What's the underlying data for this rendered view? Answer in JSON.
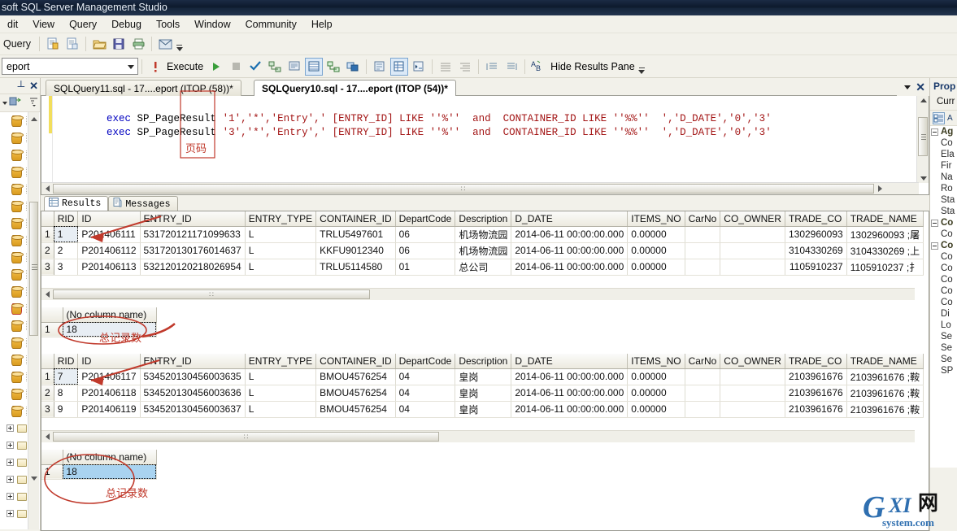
{
  "window": {
    "title": "soft SQL Server Management Studio"
  },
  "menu": {
    "items": [
      "dit",
      "View",
      "Query",
      "Debug",
      "Tools",
      "Window",
      "Community",
      "Help"
    ]
  },
  "toolbar_main": {
    "label": "Query",
    "icons": [
      "new-query-icon",
      "new-query-copy-icon",
      "open-file-icon",
      "save-icon",
      "print-icon",
      "mail-icon"
    ],
    "overflow": "toolbar-overflow-icon"
  },
  "toolbar_query": {
    "database": "eport",
    "execute_label": "Execute",
    "hide_results_label": "Hide Results Pane",
    "icons": [
      "debug-icon",
      "execute-play-icon",
      "stop-icon",
      "parse-check-icon",
      "display-estimated-plan-icon",
      "query-options-icon",
      "results-to-grid-icon",
      "include-actual-plan-icon",
      "results-to-file-icon",
      "design-query-icon",
      "specify-values-icon",
      "sqlcmd-mode-icon",
      "indent-icon",
      "outdent-icon",
      "comment-icon",
      "uncomment-icon",
      "ab-icon"
    ]
  },
  "left_panel": {
    "pin_icon": "pin-icon",
    "close_icon": "close-icon",
    "toolbar_icons": [
      "connect-icon",
      "disconnect-icon",
      "filter-icon"
    ],
    "db_count": 18,
    "folder_count": 6,
    "highlighted_index": 11
  },
  "right_panel": {
    "title": "Prop",
    "subtitle": "Curr",
    "toolbar_icons": [
      "categorized-icon",
      "alphabetical-icon"
    ],
    "groups": [
      {
        "name": "Ag",
        "items": [
          "Co",
          "Ela",
          "Fir",
          "Na",
          "Ro",
          "Sta",
          "Sta"
        ]
      },
      {
        "name": "Co",
        "items": [
          "Co"
        ]
      },
      {
        "name": "Co",
        "items": [
          "Co",
          "Co",
          "Co",
          "Co",
          "Co",
          "Di",
          "Lo",
          "Se",
          "Se",
          "Se",
          "SP"
        ]
      }
    ]
  },
  "tabs": [
    {
      "label": "SQLQuery11.sql - 17....eport (ITOP (58))*",
      "active": false
    },
    {
      "label": "SQLQuery10.sql - 17....eport (ITOP (54))*",
      "active": true
    }
  ],
  "tabstrip": {
    "dropdown_icon": "chevron-down-icon",
    "close_icon": "close-icon"
  },
  "editor": {
    "lines": [
      {
        "kw1": "exec",
        "proc": "SP_PageResult",
        "rest": " '1','*','Entry',' [ENTRY_ID] LIKE ''%''  and  CONTAINER_ID LIKE ''%%''  ','D_DATE','0','3'"
      },
      {
        "kw1": "exec",
        "proc": "SP_PageResult",
        "rest": " '3','*','Entry',' [ENTRY_ID] LIKE ''%''  and  CONTAINER_ID LIKE ''%%''  ','D_DATE','0','3'"
      }
    ],
    "scroll_grip": "‖‖"
  },
  "results_tabs": [
    {
      "label": "Results",
      "icon": "grid-icon",
      "active": true
    },
    {
      "label": "Messages",
      "icon": "message-icon",
      "active": false
    }
  ],
  "grid_columns": [
    "RID",
    "ID",
    "ENTRY_ID",
    "ENTRY_TYPE",
    "CONTAINER_ID",
    "DepartCode",
    "Description",
    "D_DATE",
    "ITEMS_NO",
    "CarNo",
    "CO_OWNER",
    "TRADE_CO",
    "TRADE_NAME"
  ],
  "grid1": {
    "rows": [
      {
        "n": "1",
        "cells": [
          "1",
          "P201406111",
          "531720121171099633",
          "L",
          "TRLU5497601",
          "06",
          "机场物流园",
          "2014-06-11 00:00:00.000",
          "0.00000",
          "",
          "",
          "1302960093",
          "1302960093 ;屠"
        ]
      },
      {
        "n": "2",
        "cells": [
          "2",
          "P201406112",
          "531720130176014637",
          "L",
          "KKFU9012340",
          "06",
          "机场物流园",
          "2014-06-11 00:00:00.000",
          "0.00000",
          "",
          "",
          "3104330269",
          "3104330269 ;上"
        ]
      },
      {
        "n": "3",
        "cells": [
          "3",
          "P201406113",
          "532120120218026954",
          "L",
          "TRLU5114580",
          "01",
          "总公司",
          "2014-06-11 00:00:00.000",
          "0.00000",
          "",
          "",
          "1105910237",
          "1105910237 ;扌"
        ]
      }
    ],
    "focus_cell": [
      0,
      0
    ]
  },
  "count1": {
    "column": "(No column name)",
    "row_number": "1",
    "value": "18",
    "selected": false
  },
  "grid2": {
    "rows": [
      {
        "n": "1",
        "cells": [
          "7",
          "P201406117",
          "534520130456003635",
          "L",
          "BMOU4576254",
          "04",
          "皇岗",
          "2014-06-11 00:00:00.000",
          "0.00000",
          "",
          "",
          "2103961676",
          "2103961676 ;鞍"
        ]
      },
      {
        "n": "2",
        "cells": [
          "8",
          "P201406118",
          "534520130456003636",
          "L",
          "BMOU4576254",
          "04",
          "皇岗",
          "2014-06-11 00:00:00.000",
          "0.00000",
          "",
          "",
          "2103961676",
          "2103961676 ;鞍"
        ]
      },
      {
        "n": "3",
        "cells": [
          "9",
          "P201406119",
          "534520130456003637",
          "L",
          "BMOU4576254",
          "04",
          "皇岗",
          "2014-06-11 00:00:00.000",
          "0.00000",
          "",
          "",
          "2103961676",
          "2103961676 ;鞍"
        ]
      }
    ],
    "focus_cell": [
      0,
      0
    ]
  },
  "count2": {
    "column": "(No column name)",
    "row_number": "1",
    "value": "18",
    "selected": true
  },
  "annotations": [
    {
      "name": "page-number-note",
      "text": "页码"
    },
    {
      "name": "total-records-note-1",
      "text": "总记录数"
    },
    {
      "name": "total-records-note-2",
      "text": "总记录数"
    }
  ],
  "watermark": {
    "g": "G",
    "xi": "XI",
    "cn": "网",
    "system": "system.com"
  },
  "colors": {
    "accent": "#c0392b",
    "selection": "#a9d3f0",
    "title_bar": "#16263c",
    "chrome": "#f2f1ea",
    "sql_string": "#a31515",
    "sql_keyword": "#0000c0"
  }
}
